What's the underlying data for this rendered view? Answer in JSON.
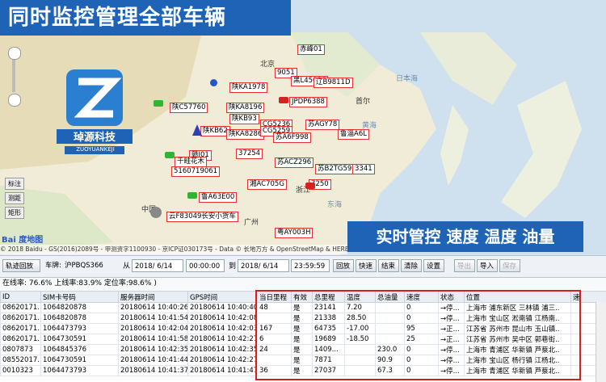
{
  "banner": {
    "title": "同时监控管理全部车辆"
  },
  "promo": {
    "text": "实时管控 速度 温度 油量"
  },
  "logo": {
    "name": "琸源科技",
    "sub": "ZUOYUANKEJI"
  },
  "map": {
    "baidu_logo": "Bai 度地图",
    "attribution": "© 2018 Baidu - GS(2016)2089号 - 甲测资字1100930 - 京ICP证030173号 - Data © 长地万方 & OpenStreetMap & HERE",
    "side_buttons": [
      "标注",
      "测距",
      "矩形"
    ],
    "cities": [
      {
        "text": "北京"
      },
      {
        "text": "黄海"
      },
      {
        "text": "日本海"
      },
      {
        "text": "中国"
      },
      {
        "text": "广州"
      },
      {
        "text": "东海"
      },
      {
        "text": "首尔"
      },
      {
        "text": "浙江"
      }
    ],
    "vehicle_labels": [
      "赤峰01",
      "9051",
      "黑L45086",
      "辽B9811D",
      "陕KA1978",
      "JPDP6388",
      "陕C57760",
      "陕KA8196",
      "陕KB93",
      "陕KB62",
      "陕KA8286",
      "CG5236",
      "CG5259",
      "苏A6F998",
      "苏AGY78",
      "鲁淄A6L",
      "37254",
      "赣J01",
      "千畦花木",
      "5160719061",
      "鲁A63E00",
      "苏ACZ296",
      "苏B2TG59",
      "3341",
      "7250",
      "湘AC705G",
      "云F83049长安小货车",
      "粤AY003H"
    ]
  },
  "toolbar": {
    "track_replay": "轨迹回放",
    "vehicle_label": "车牌:",
    "vehicle_value": "沪PBQS366",
    "from_label": "从",
    "date_from": "2018/ 6/14",
    "time_from": "00:00:00",
    "to_label": "到",
    "date_to": "2018/ 6/14",
    "time_to": "23:59:59",
    "btn_replay": "回放",
    "btn_fast": "快速",
    "btn_end": "结束",
    "btn_clear": "清除",
    "btn_settings": "设置",
    "btn_export": "导出",
    "btn_import": "导入",
    "btn_save": "保存"
  },
  "status": {
    "text": "在线率: 76.6% 上线率:83.9% 定位率:98.6% )"
  },
  "table": {
    "headers": [
      "ID",
      "SIM卡号码",
      "服务器时间",
      "GPS时间",
      "当日里程",
      "有效",
      "总里程",
      "温度",
      "总油量",
      "速度",
      "状态",
      "位置",
      "速"
    ],
    "rows": [
      [
        "08620171...",
        "1064820878",
        "20180614 10:40:26",
        "20180614 10:40:40",
        "48",
        "是",
        "23141",
        "7.20",
        "",
        "0",
        "→停...",
        "上海市 浦东新区 三林镇 浦三..",
        ""
      ],
      [
        "08620171...",
        "1064820878",
        "20180614 10:41:54",
        "20180614 10:42:08",
        "",
        "是",
        "21338",
        "28.50",
        "",
        "0",
        "→停...",
        "上海市 宝山区 淞南镇 江杨南..",
        ""
      ],
      [
        "08620171...",
        "1064473793",
        "20180614 10:42:04",
        "20180614 10:42:03",
        "167",
        "是",
        "64735",
        "-17.00",
        "",
        "95",
        "→正...",
        "江苏省 苏州市 昆山市 玉山镇..",
        ""
      ],
      [
        "08620171...",
        "1064730591",
        "20180614 10:41:58",
        "20180614 10:42:27",
        "6",
        "是",
        "19689",
        "-18.50",
        "",
        "25",
        "→正...",
        "江苏省 苏州市 吴中区 郭巷街..",
        ""
      ],
      [
        "0807873",
        "1064845376",
        "20180614 10:42:35",
        "20180614 10:42:35",
        "24",
        "是",
        "1409...",
        "",
        "230.0",
        "0",
        "→停...",
        "上海市 青浦区 华新镇 芦蔡北..",
        ""
      ],
      [
        "08552017...",
        "1064730591",
        "20180614 10:41:44",
        "20180614 10:42:27",
        "",
        "是",
        "7871",
        "",
        "90.9",
        "0",
        "→停...",
        "上海市 宝山区 杨行镇 江杨北..",
        ""
      ],
      [
        "0010323",
        "1064473793",
        "20180614 10:41:37",
        "20180614 10:41:47",
        "36",
        "是",
        "27037",
        "",
        "67.3",
        "0",
        "→停...",
        "上海市 青浦区 华新镇 芦蔡北..",
        ""
      ]
    ]
  },
  "colors": {
    "banner": "#1e63b6",
    "highlight": "#d71e1e"
  }
}
